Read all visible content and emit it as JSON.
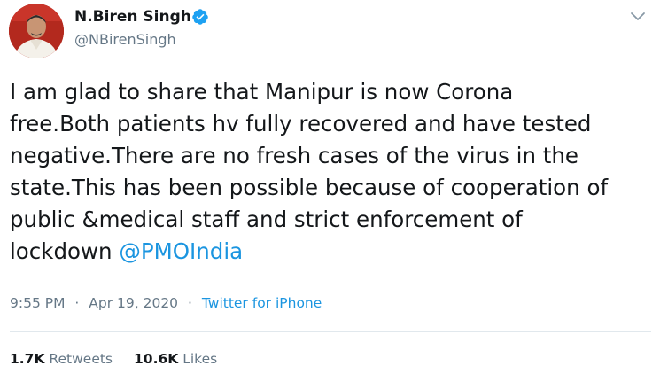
{
  "tweet": {
    "author": {
      "display_name": "N.Biren Singh",
      "handle": "@NBirenSingh",
      "verified": true,
      "avatar": "profile-avatar"
    },
    "text_lines": [
      "I am glad to share that Manipur is now Corona",
      "free.Both patients hv fully recovered and have tested",
      "negative.There are no fresh cases of the virus in the",
      "state.This has been possible because of cooperation of",
      "public &medical staff and strict enforcement of",
      "lockdown "
    ],
    "mention": "@PMOIndia",
    "time": "9:55 PM",
    "date": "Apr 19, 2020",
    "separator": "·",
    "source": "Twitter for iPhone",
    "retweets": {
      "count": "1.7K",
      "label": "Retweets"
    },
    "likes": {
      "count": "10.6K",
      "label": "Likes"
    }
  },
  "icons": {
    "verified": "verified-badge-icon",
    "menu": "chevron-down-icon"
  },
  "colors": {
    "text": "#14171a",
    "secondary": "#657786",
    "link": "#1b95e0",
    "divider": "#e1e8ed"
  }
}
